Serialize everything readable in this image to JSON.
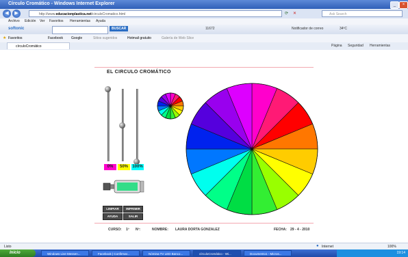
{
  "window": {
    "title": "Círculo Cromático - Windows Internet Explorer"
  },
  "address": {
    "url_prefix": "http://www.",
    "url_domain": "educacionplastica.net",
    "url_path": "/circuloCromatico.html",
    "search_placeholder": "Ask Search"
  },
  "menu": [
    "Archivo",
    "Edición",
    "Ver",
    "Favoritos",
    "Herramientas",
    "Ayuda"
  ],
  "toolbar": {
    "softonic_label": "softonic",
    "buscar_label": "BUSCAR",
    "count_label": "11672",
    "notificador_label": "Notificador de correo",
    "temperature": "34ºC"
  },
  "favorites": {
    "label": "Favoritos",
    "items": [
      "Facebook",
      "Google",
      "Sitios sugeridos",
      "Hotmail gratuito",
      "Galería de Web Slice"
    ]
  },
  "tab": {
    "label": "círculoCromático"
  },
  "tab_tools": [
    "Página",
    "Seguridad",
    "Herramientas"
  ],
  "page": {
    "title": "EL CIRCULO CROMÁTICO",
    "percent_magenta": "0%",
    "percent_yellow": "50%",
    "percent_cyan": "100%",
    "buttons": {
      "limpiar": "LIMPIAR",
      "imprimir": "IMPRIMIR",
      "ayuda": "AYUDA",
      "salir": "SALIR"
    },
    "footer": {
      "curso_label": "CURSO:",
      "curso_value": "1º",
      "num_label": "Nº:",
      "nombre_label": "NOMBRE:",
      "nombre_value": "LAURA DORTA GONZALEZ",
      "fecha_label": "FECHA:",
      "fecha_value": "29 - 4 - 2010"
    },
    "wheel_colors": [
      "#ff00cc",
      "#ff1a75",
      "#ff0000",
      "#ff7700",
      "#ffcc00",
      "#ffff00",
      "#99ff00",
      "#33ee33",
      "#00dd44",
      "#00ff88",
      "#00ffee",
      "#0077ff",
      "#0022ee",
      "#5500dd",
      "#9900ee",
      "#dd00ff"
    ],
    "sliders": {
      "magenta": 0,
      "yellow": 0.5,
      "cyan": 1
    }
  },
  "status": {
    "left": "Listo",
    "zone": "Internet",
    "zoom": "100%"
  },
  "taskbar": {
    "start": "Inicio",
    "tasks": [
      "Windows Live Messen...",
      "Facebook | Confirmar...",
      "Nómina TV LED Banco...",
      "círculoCromático - Wi...",
      "Documento1 - Micros..."
    ],
    "clock": "19:14"
  }
}
